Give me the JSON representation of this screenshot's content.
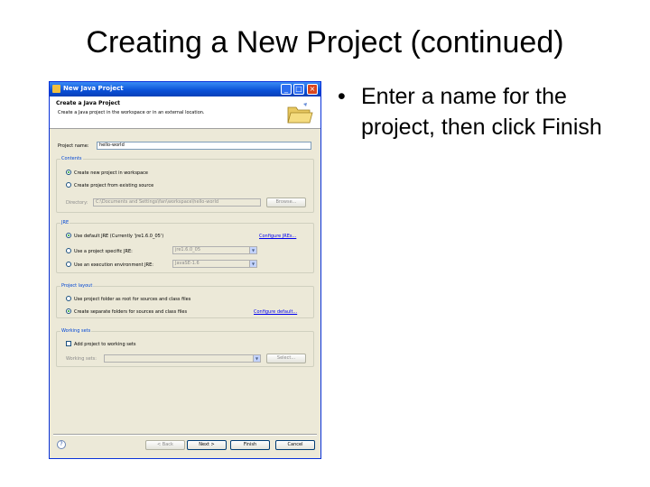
{
  "slide": {
    "title": "Creating a New Project (continued)",
    "bullet_marker": "•",
    "bullet_text": "Enter a name for the project, then click Finish"
  },
  "window": {
    "title": "New Java Project",
    "min": "_",
    "max": "□",
    "close": "×"
  },
  "header": {
    "title": "Create a Java Project",
    "description": "Create a Java project in the workspace or in an external location."
  },
  "form": {
    "project_name_label": "Project name:",
    "project_name_value": "hello-world"
  },
  "contents": {
    "label": "Contents",
    "option_new": "Create new project in workspace",
    "option_existing": "Create project from existing source",
    "directory_label": "Directory:",
    "directory_value": "C:\\Documents and Settings\\fan\\workspace\\hello-world",
    "browse_button": "Browse..."
  },
  "jre": {
    "label": "JRE",
    "option_default": "Use default JRE (Currently 'jre1.6.0_05')",
    "configure_link": "Configure JREs...",
    "option_specific": "Use a project specific JRE:",
    "specific_value": "jre1.6.0_05",
    "option_env": "Use an execution environment JRE:",
    "env_value": "JavaSE-1.6"
  },
  "layout": {
    "label": "Project layout",
    "option_root": "Use project folder as root for sources and class files",
    "option_separate": "Create separate folders for sources and class files",
    "configure_link": "Configure default..."
  },
  "working_sets": {
    "label": "Working sets",
    "add_checkbox": "Add project to working sets",
    "sets_label": "Working sets:",
    "select_button": "Select..."
  },
  "footer": {
    "help": "?",
    "back": "< Back",
    "next": "Next >",
    "finish": "Finish",
    "cancel": "Cancel"
  },
  "icons": [
    "window-app-icon",
    "folder-icon",
    "help-icon"
  ],
  "colors": {
    "titlebar": "#0a4fd6",
    "dialog_bg": "#ece9d8",
    "group_label": "#0046d5",
    "link": "#0000ee"
  }
}
